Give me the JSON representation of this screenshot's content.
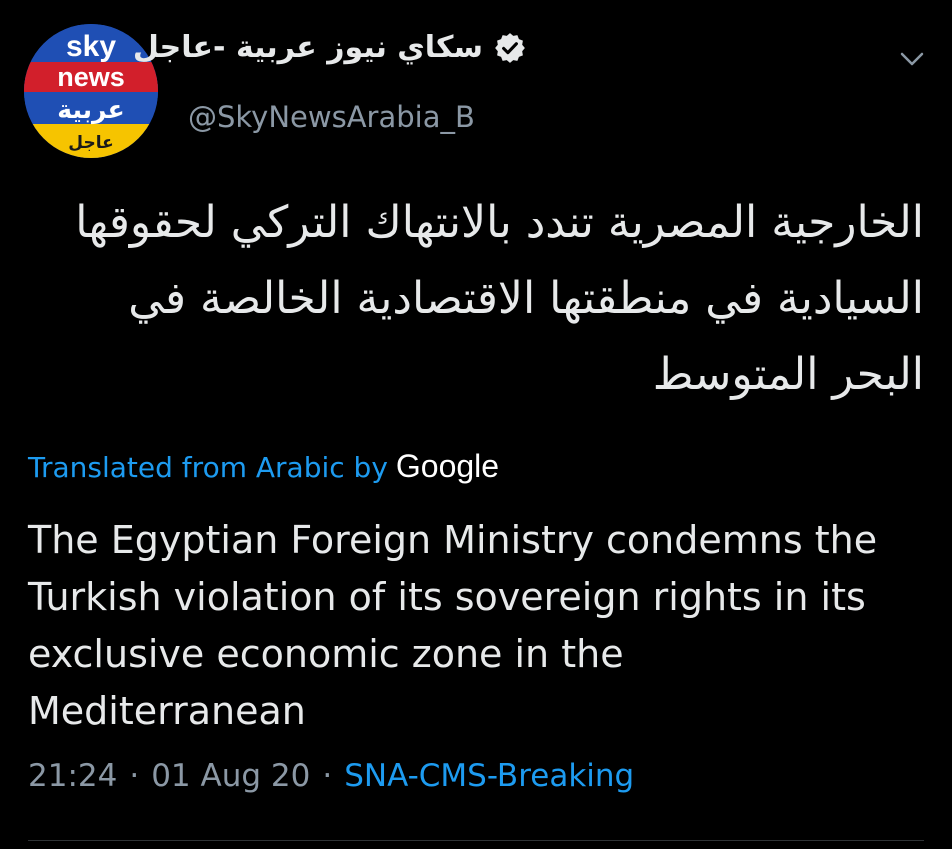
{
  "account": {
    "display_name": "سكاي نيوز عربية -عاجل",
    "handle": "@SkyNewsArabia_B",
    "verified": true,
    "avatar": {
      "line1": "sky",
      "line2": "news",
      "line3": "عربية",
      "line4": "عاجل"
    }
  },
  "tweet": {
    "arabic_text": "الخارجية المصرية تندد بالانتهاك التركي لحقوقها السيادية في منطقتها الاقتصادية الخالصة في البحر المتوسط",
    "translated_label": "Translated from Arabic by",
    "translated_provider": "Google",
    "english_text": "The Egyptian Foreign Ministry condemns the Turkish violation of its sovereign rights in its exclusive economic zone in the Mediterranean",
    "time": "21:24",
    "date": "01 Aug 20",
    "source": "SNA-CMS-Breaking",
    "separator": "·"
  },
  "icons": {
    "verified": "verified-badge-icon",
    "more": "chevron-down-icon"
  },
  "colors": {
    "background": "#000000",
    "text": "#e7e9ea",
    "muted": "#8b98a5",
    "link": "#1d9bf0",
    "avatar_blue": "#1f4fb4",
    "avatar_red": "#d21f2b",
    "avatar_yellow": "#f6c400"
  }
}
